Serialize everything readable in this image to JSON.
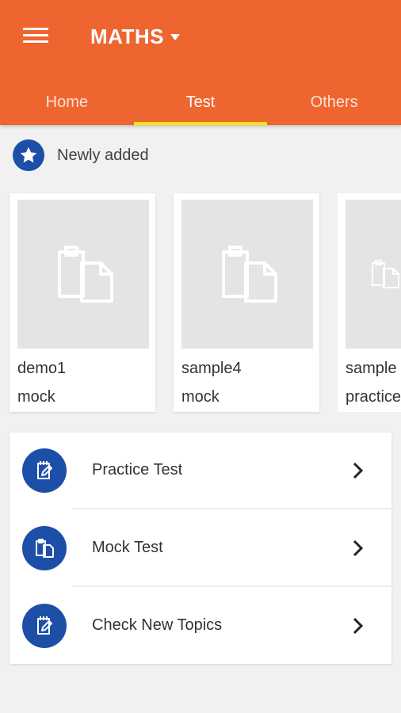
{
  "header": {
    "title": "MATHS",
    "brand_color": "#ee6530",
    "tab_indicator_color": "#f8e418",
    "menu_icon": "hamburger-menu-icon",
    "title_dropdown_icon": "caret-down-icon"
  },
  "tabs": [
    {
      "label": "Home",
      "active": false
    },
    {
      "label": "Test",
      "active": true
    },
    {
      "label": "Others",
      "active": false
    }
  ],
  "newly_added": {
    "label": "Newly added",
    "icon": "star-icon",
    "icon_color": "#1e4fa8"
  },
  "cards": [
    {
      "name": "demo1",
      "type": "mock",
      "icon": "clipboard-icon"
    },
    {
      "name": "sample4",
      "type": "mock",
      "icon": "clipboard-icon"
    },
    {
      "name": "sample",
      "type": "practice",
      "icon": "clipboard-icon"
    }
  ],
  "menu_list": [
    {
      "label": "Practice Test",
      "icon": "notepad-edit-icon"
    },
    {
      "label": "Mock Test",
      "icon": "clipboard-copy-icon"
    },
    {
      "label": "Check New Topics",
      "icon": "notepad-edit-icon"
    }
  ]
}
